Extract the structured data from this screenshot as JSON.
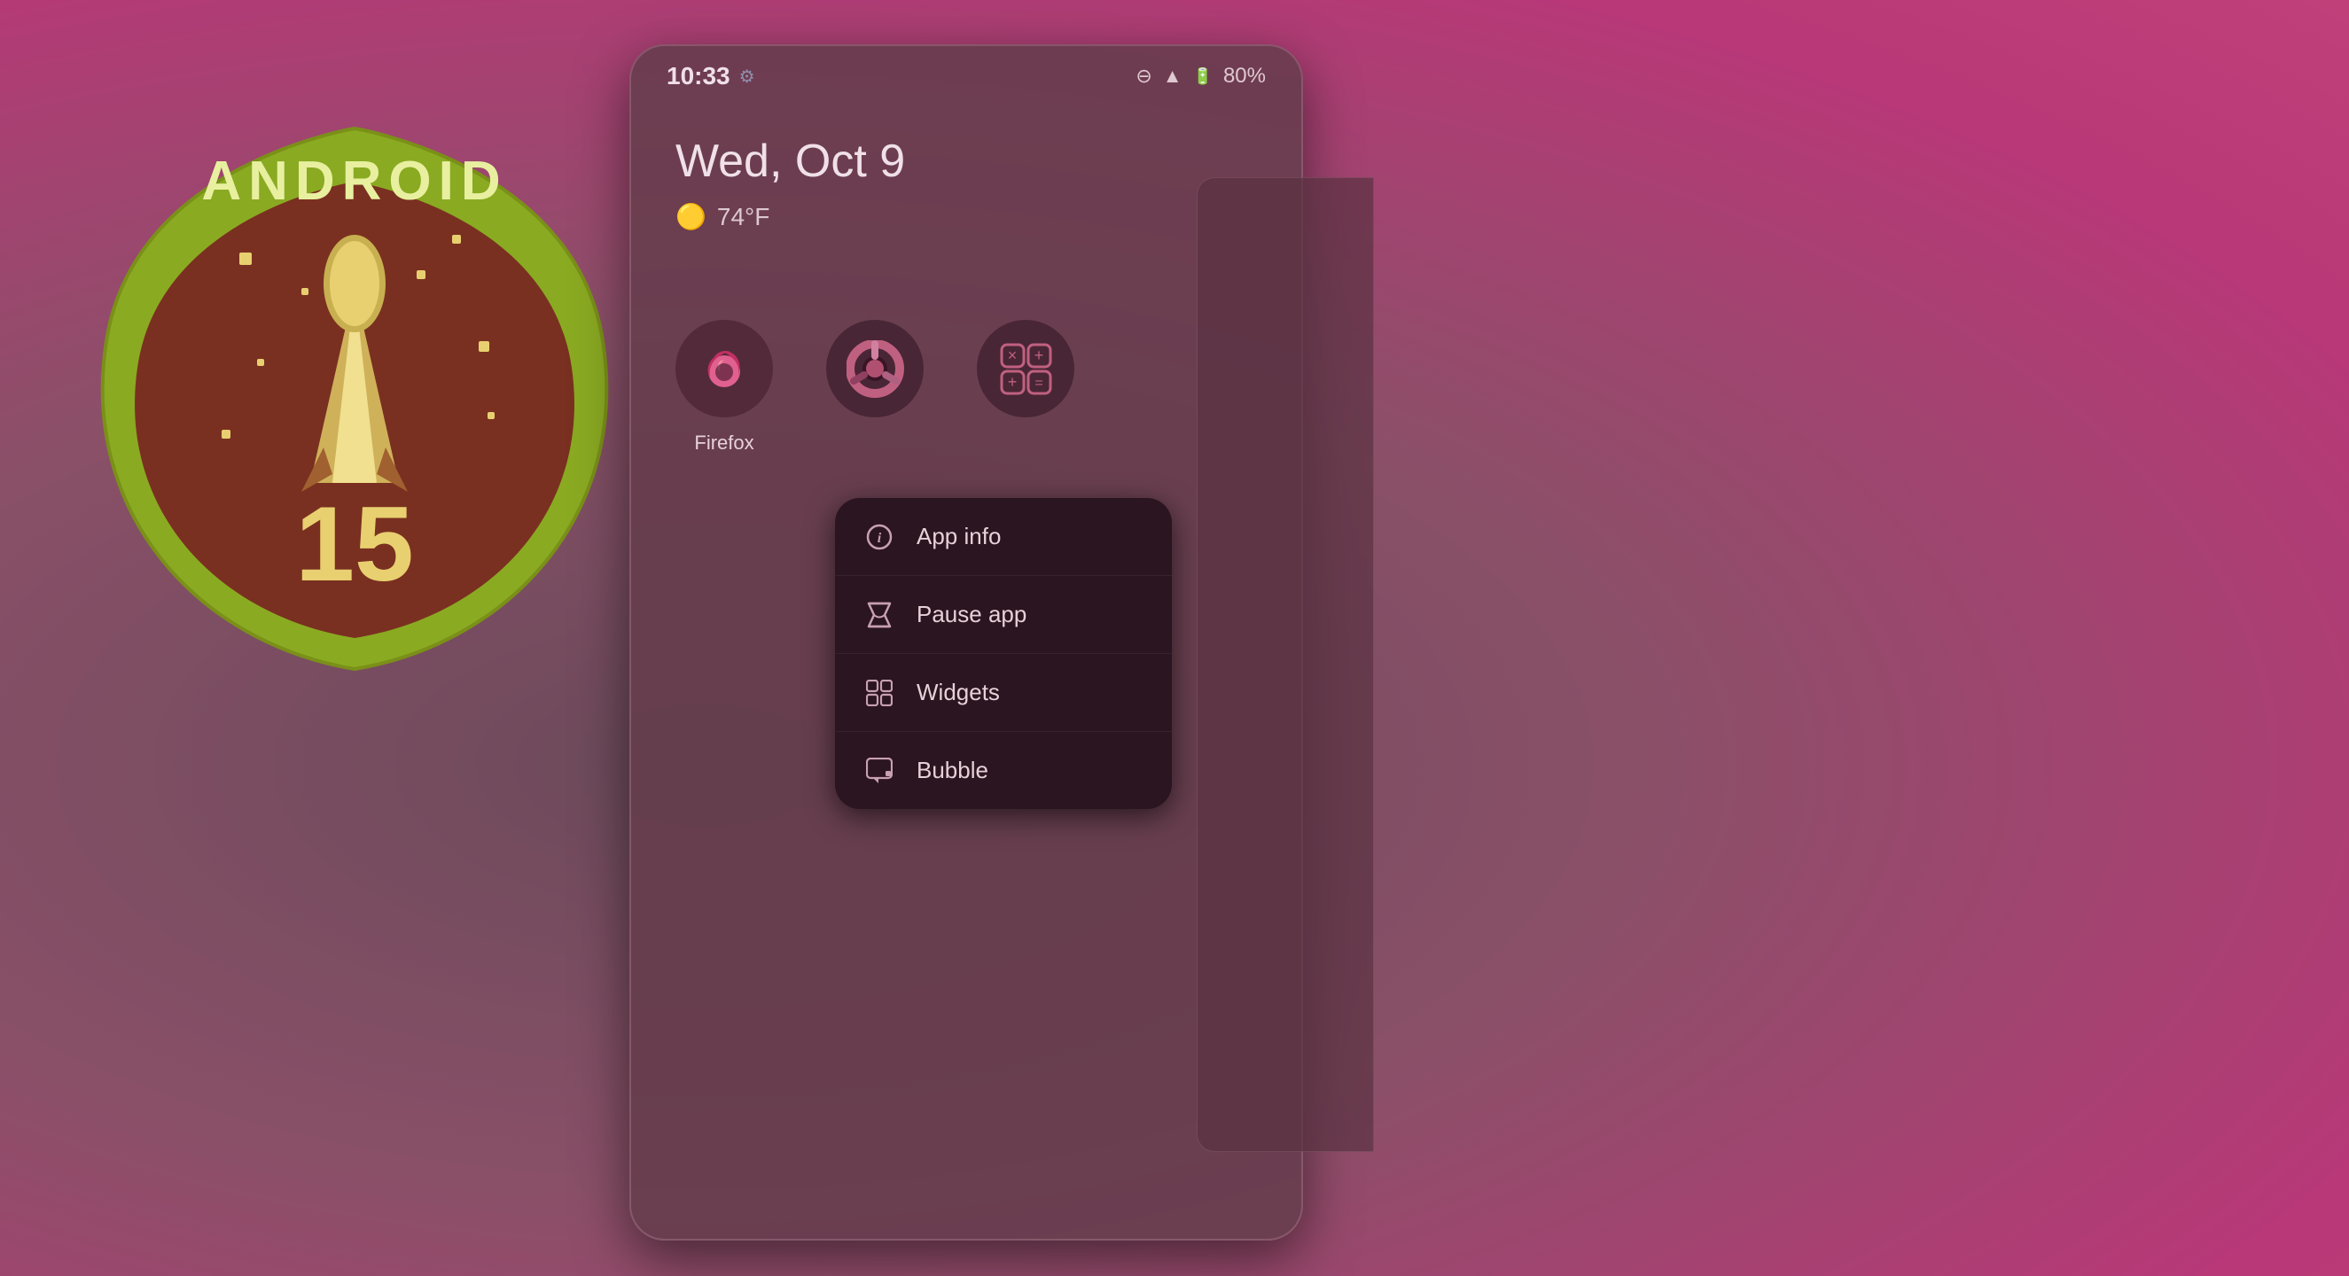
{
  "background": {
    "color_start": "#7a5c6e",
    "color_end": "#c0407a"
  },
  "badge": {
    "title": "ANDROID",
    "version": "15",
    "outer_color": "#7a9020",
    "inner_color": "#7a3020",
    "text_color": "#e8d070"
  },
  "phone": {
    "status_bar": {
      "time": "10:33",
      "battery": "80%",
      "icons": [
        "do-not-disturb",
        "wifi",
        "battery"
      ]
    },
    "date": "Wed, Oct 9",
    "weather": {
      "icon": "🟡",
      "temperature": "74°F"
    },
    "apps": [
      {
        "name": "Firefox",
        "icon_type": "firefox"
      },
      {
        "name": "Chrome",
        "icon_type": "chrome"
      },
      {
        "name": "Calculator",
        "icon_type": "calculator"
      }
    ],
    "context_menu": {
      "items": [
        {
          "id": "app-info",
          "label": "App info",
          "icon": "info"
        },
        {
          "id": "pause-app",
          "label": "Pause app",
          "icon": "hourglass"
        },
        {
          "id": "widgets",
          "label": "Widgets",
          "icon": "widgets"
        },
        {
          "id": "bubble",
          "label": "Bubble",
          "icon": "bubble"
        }
      ]
    }
  }
}
